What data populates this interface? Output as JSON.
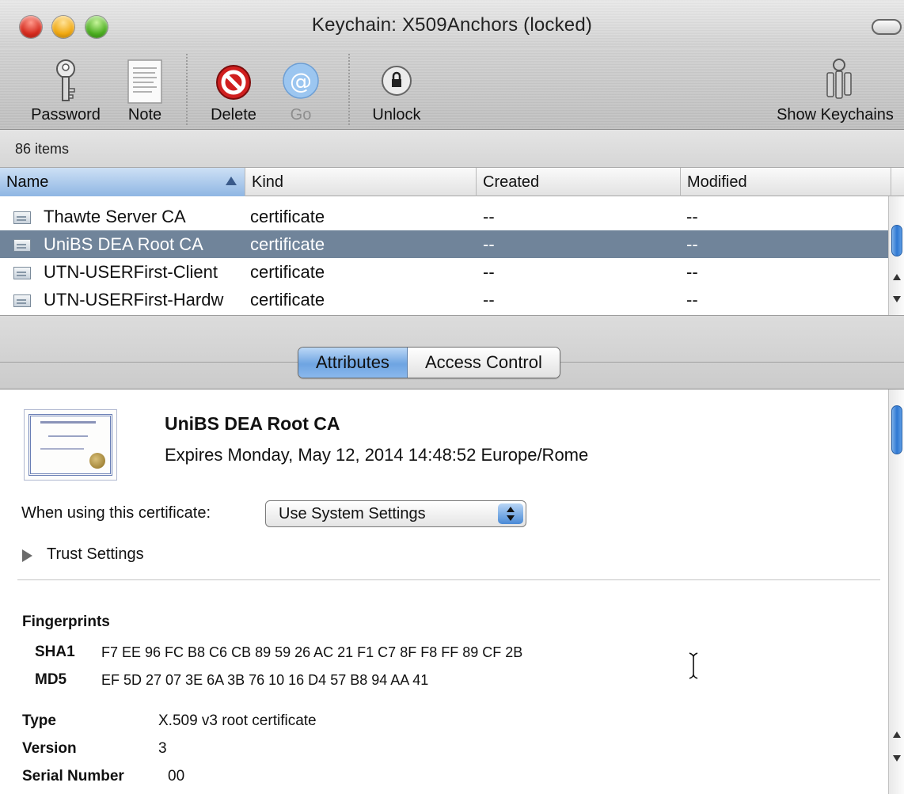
{
  "window": {
    "title": "Keychain: X509Anchors (locked)"
  },
  "toolbar": {
    "items": [
      {
        "label": "Password",
        "icon": "key-icon",
        "enabled": true
      },
      {
        "label": "Note",
        "icon": "note-icon",
        "enabled": true
      },
      {
        "label": "Delete",
        "icon": "delete-icon",
        "enabled": true
      },
      {
        "label": "Go",
        "icon": "go-at-icon",
        "enabled": false
      },
      {
        "label": "Unlock",
        "icon": "lock-icon",
        "enabled": true
      },
      {
        "label": "Show Keychains",
        "icon": "keychain-icon",
        "enabled": true
      }
    ]
  },
  "status": {
    "count": "86 items"
  },
  "table": {
    "columns": [
      "Name",
      "Kind",
      "Created",
      "Modified"
    ],
    "sorted_column": "Name",
    "rows": [
      {
        "name": "Thawte Server CA",
        "kind": "certificate",
        "created": "--",
        "modified": "--",
        "selected": false
      },
      {
        "name": "UniBS DEA Root CA",
        "kind": "certificate",
        "created": "--",
        "modified": "--",
        "selected": true
      },
      {
        "name": "UTN-USERFirst-Client",
        "kind": "certificate",
        "created": "--",
        "modified": "--",
        "selected": false
      },
      {
        "name": "UTN-USERFirst-Hardw",
        "kind": "certificate",
        "created": "--",
        "modified": "--",
        "selected": false
      }
    ]
  },
  "tabs": {
    "attributes": "Attributes",
    "access_control": "Access Control",
    "active": "Attributes"
  },
  "detail": {
    "cert_name": "UniBS DEA Root CA",
    "expires": "Expires Monday, May 12, 2014 14:48:52 Europe/Rome",
    "when_using_label": "When using this certificate:",
    "trust_select_value": "Use System Settings",
    "trust_settings_label": "Trust Settings",
    "fingerprints_title": "Fingerprints",
    "sha1_label": "SHA1",
    "sha1_value": "F7 EE 96 FC B8 C6 CB 89 59 26 AC 21 F1 C7 8F F8 FF 89 CF 2B",
    "md5_label": "MD5",
    "md5_value": "EF 5D 27 07 3E 6A 3B 76 10 16 D4 57 B8 94 AA 41",
    "type_label": "Type",
    "type_value": "X.509 v3 root certificate",
    "version_label": "Version",
    "version_value": "3",
    "serial_label": "Serial Number",
    "serial_value": "00"
  },
  "colors": {
    "selection": "#70849a",
    "accent_blue": "#4a8ad6"
  }
}
